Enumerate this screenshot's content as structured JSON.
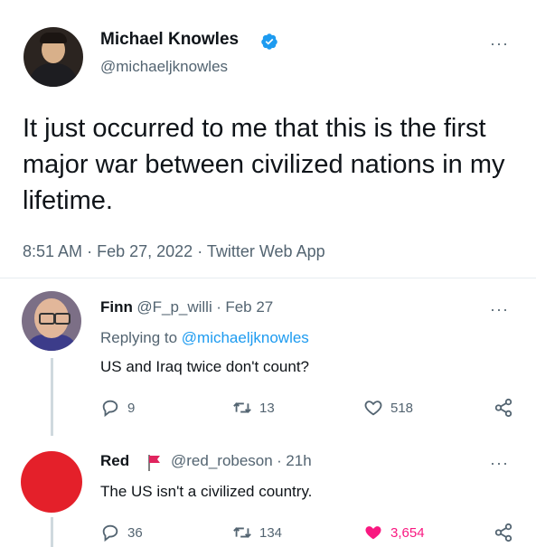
{
  "tweet": {
    "author_name": "Michael Knowles",
    "author_handle": "@michaeljknowles",
    "text": "It just occurred to me that this is the first major war between civilized nations in my lifetime.",
    "time": "8:51 AM",
    "date": "Feb 27, 2022",
    "source": "Twitter Web App",
    "meta_sep": "·",
    "verified_color": "#1d9bf0"
  },
  "replies": [
    {
      "name": "Finn",
      "handle": "@F_p_willi",
      "time": "Feb 27",
      "replying_prefix": "Replying to ",
      "replying_to": "@michaeljknowles",
      "text": "US and Iraq twice don't count?",
      "stats": {
        "replies": "9",
        "retweets": "13",
        "likes": "518"
      },
      "liked": false
    },
    {
      "name": "Red",
      "handle": "@red_robeson",
      "time": "21h",
      "text": "The US isn't a civilized country.",
      "stats": {
        "replies": "36",
        "retweets": "134",
        "likes": "3,654"
      },
      "liked": true,
      "like_color": "#f91880",
      "flag_color": "#e0245e",
      "avatar_color": "#e4202a"
    }
  ],
  "icons": {
    "more": "more-icon",
    "reply": "reply-icon",
    "retweet": "retweet-icon",
    "like": "heart-icon",
    "share": "share-icon"
  },
  "more_glyph": "···"
}
